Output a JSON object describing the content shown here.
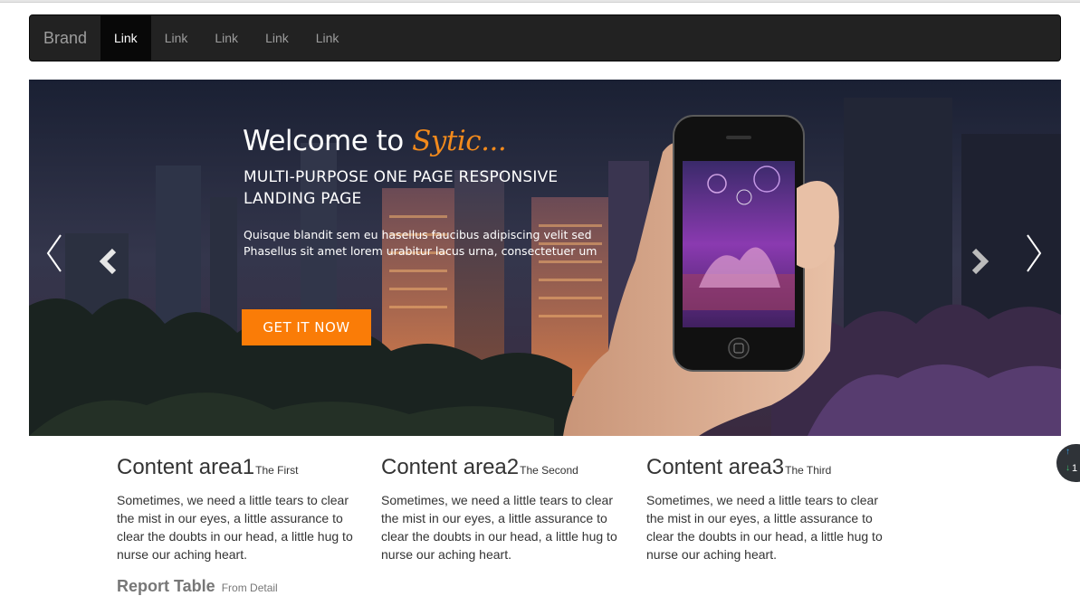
{
  "navbar": {
    "brand": "Brand",
    "links": [
      "Link",
      "Link",
      "Link",
      "Link",
      "Link"
    ],
    "active_index": 0
  },
  "hero": {
    "title_prefix": "Welcome to",
    "title_accent": "Sytic...",
    "subtitle": "MULTI-PURPOSE ONE PAGE RESPONSIVE LANDING PAGE",
    "description": "Quisque blandit sem eu hasellus faucibus adipiscing velit sed Phasellus sit amet lorem urabitur lacus urna, consectetuer um",
    "cta_label": "GET IT NOW",
    "accent_color": "#f28a1c",
    "cta_color": "#fa7c07"
  },
  "content_areas": [
    {
      "title": "Content area1",
      "subtitle": "The First",
      "body": "Sometimes, we need a little tears to clear the mist in our eyes, a little assurance to clear the doubts in our head, a little hug to nurse our aching heart."
    },
    {
      "title": "Content area2",
      "subtitle": "The Second",
      "body": "Sometimes, we need a little tears to clear the mist in our eyes, a little assurance to clear the doubts in our head, a little hug to nurse our aching heart."
    },
    {
      "title": "Content area3",
      "subtitle": "The Third",
      "body": "Sometimes, we need a little tears to clear the mist in our eyes, a little assurance to clear the doubts in our head, a little hug to nurse our aching heart."
    }
  ],
  "report": {
    "title": "Report Table",
    "subtitle": "From Detail"
  },
  "widget": {
    "up_icon": "arrow-up-icon",
    "down_icon": "arrow-down-icon",
    "count": "1"
  }
}
